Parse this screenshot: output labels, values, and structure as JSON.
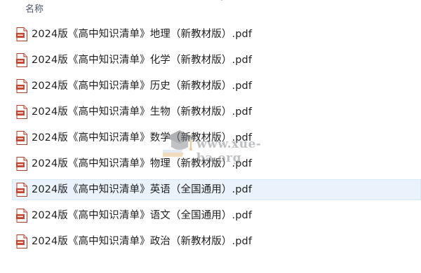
{
  "header": {
    "name_column_label": "名称"
  },
  "files": [
    {
      "label": "2024版《高中知识清单》地理（新教材版）.pdf",
      "icon": "pdf-file-icon"
    },
    {
      "label": "2024版《高中知识清单》化学（新教材版）.pdf",
      "icon": "pdf-file-icon"
    },
    {
      "label": "2024版《高中知识清单》历史（新教材版）.pdf",
      "icon": "pdf-file-icon"
    },
    {
      "label": "2024版《高中知识清单》生物（新教材版）.pdf",
      "icon": "pdf-file-icon"
    },
    {
      "label": "2024版《高中知识清单》数学（新教材版）.pdf",
      "icon": "pdf-file-icon"
    },
    {
      "label": "2024版《高中知识清单》物理（新教材版）.pdf",
      "icon": "pdf-file-icon"
    },
    {
      "label": "2024版《高中知识清单》英语（全国通用）.pdf",
      "icon": "pdf-file-icon",
      "selected": true
    },
    {
      "label": "2024版《高中知识清单》语文（全国通用）.pdf",
      "icon": "pdf-file-icon"
    },
    {
      "label": "2024版《高中知识清单》政治（新教材版）.pdf",
      "icon": "pdf-file-icon"
    }
  ],
  "watermark": {
    "text": "www.xue-ba.org"
  },
  "colors": {
    "selection_background": "#eaf3fb",
    "pdf_icon_red": "#c8452f",
    "header_text": "#4c5a6b"
  }
}
